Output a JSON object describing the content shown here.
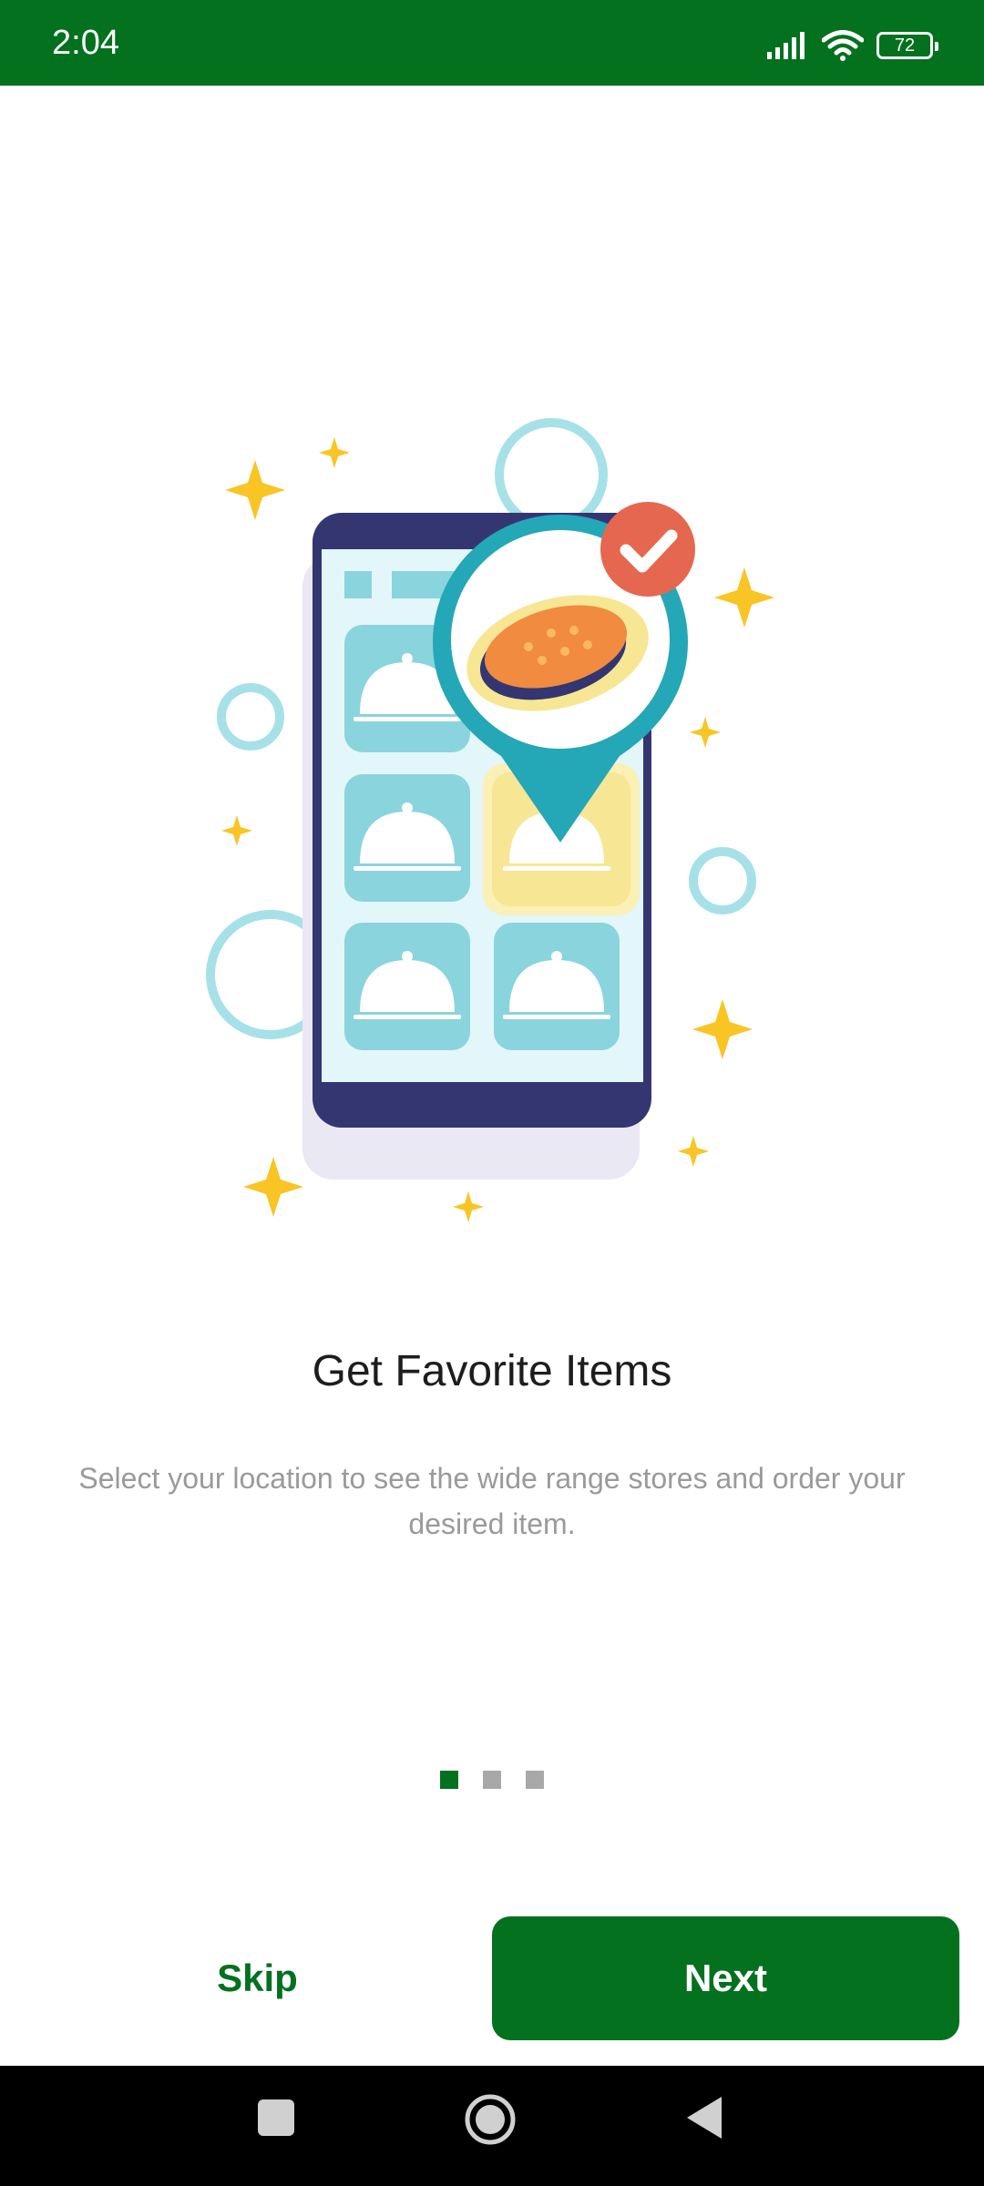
{
  "status_bar": {
    "time": "2:04",
    "battery_level": "72",
    "icons": [
      "signal-icon",
      "wifi-icon",
      "battery-icon"
    ]
  },
  "onboarding": {
    "illustration": "phone-food-location-illustration",
    "title": "Get Favorite Items",
    "description": "Select your location to see the wide range stores and order your desired item.",
    "page_indicator": {
      "current": 1,
      "total": 3
    }
  },
  "actions": {
    "skip_label": "Skip",
    "next_label": "Next"
  },
  "nav_bar": {
    "buttons": [
      "recents-button",
      "home-button",
      "back-button"
    ]
  },
  "colors": {
    "brand": "#03711e",
    "status_bar": "#03711e",
    "inactive_dot": "#a8a8a8",
    "title": "#1d1d1d",
    "description": "#9a9a9a"
  }
}
